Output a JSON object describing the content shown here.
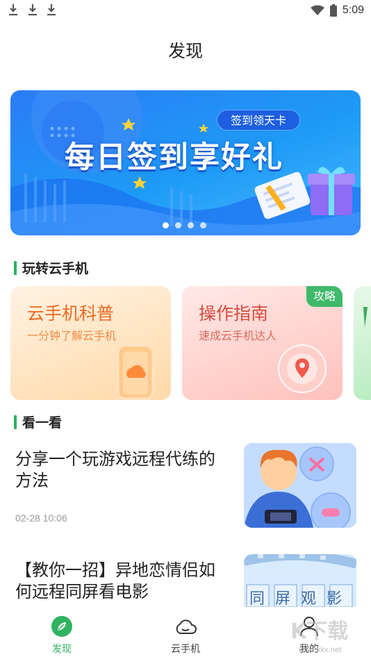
{
  "status_bar": {
    "time": "5:09",
    "icons": [
      "download-icon",
      "download-icon",
      "download-icon",
      "wifi-icon",
      "battery-icon"
    ]
  },
  "header": {
    "title": "发现"
  },
  "banner": {
    "badge": "签到领天卡",
    "headline": "每日签到享好礼",
    "page_count": 4,
    "active_page": 1
  },
  "section_play": {
    "heading": "玩转云手机",
    "cards": [
      {
        "title": "云手机科普",
        "subtitle": "一分钟了解云手机",
        "icon": "phone-cloud-icon"
      },
      {
        "title": "操作指南",
        "subtitle": "速成云手机达人",
        "tag": "攻略",
        "icon": "location-pin-icon"
      }
    ]
  },
  "section_watch": {
    "heading": "看一看",
    "articles": [
      {
        "title": "分享一个玩游戏远程代练的方法",
        "date": "02-28 10:06"
      },
      {
        "title": "【教你一招】异地恋情侣如何远程同屏看电影",
        "thumb_text": "同 屏 观 影"
      }
    ]
  },
  "tab_bar": {
    "tabs": [
      {
        "label": "发现",
        "icon": "compass-leaf-icon",
        "active": true
      },
      {
        "label": "云手机",
        "icon": "cloud-icon",
        "active": false
      },
      {
        "label": "我的",
        "icon": "user-icon",
        "active": false
      }
    ]
  },
  "watermark": {
    "text": "K下载",
    "url": "www.kkx.net"
  },
  "colors": {
    "accent_green": "#2fb360",
    "banner_blue": "#1d9bf6",
    "card_orange": "#ef6a22",
    "card_red": "#d74b3c"
  }
}
